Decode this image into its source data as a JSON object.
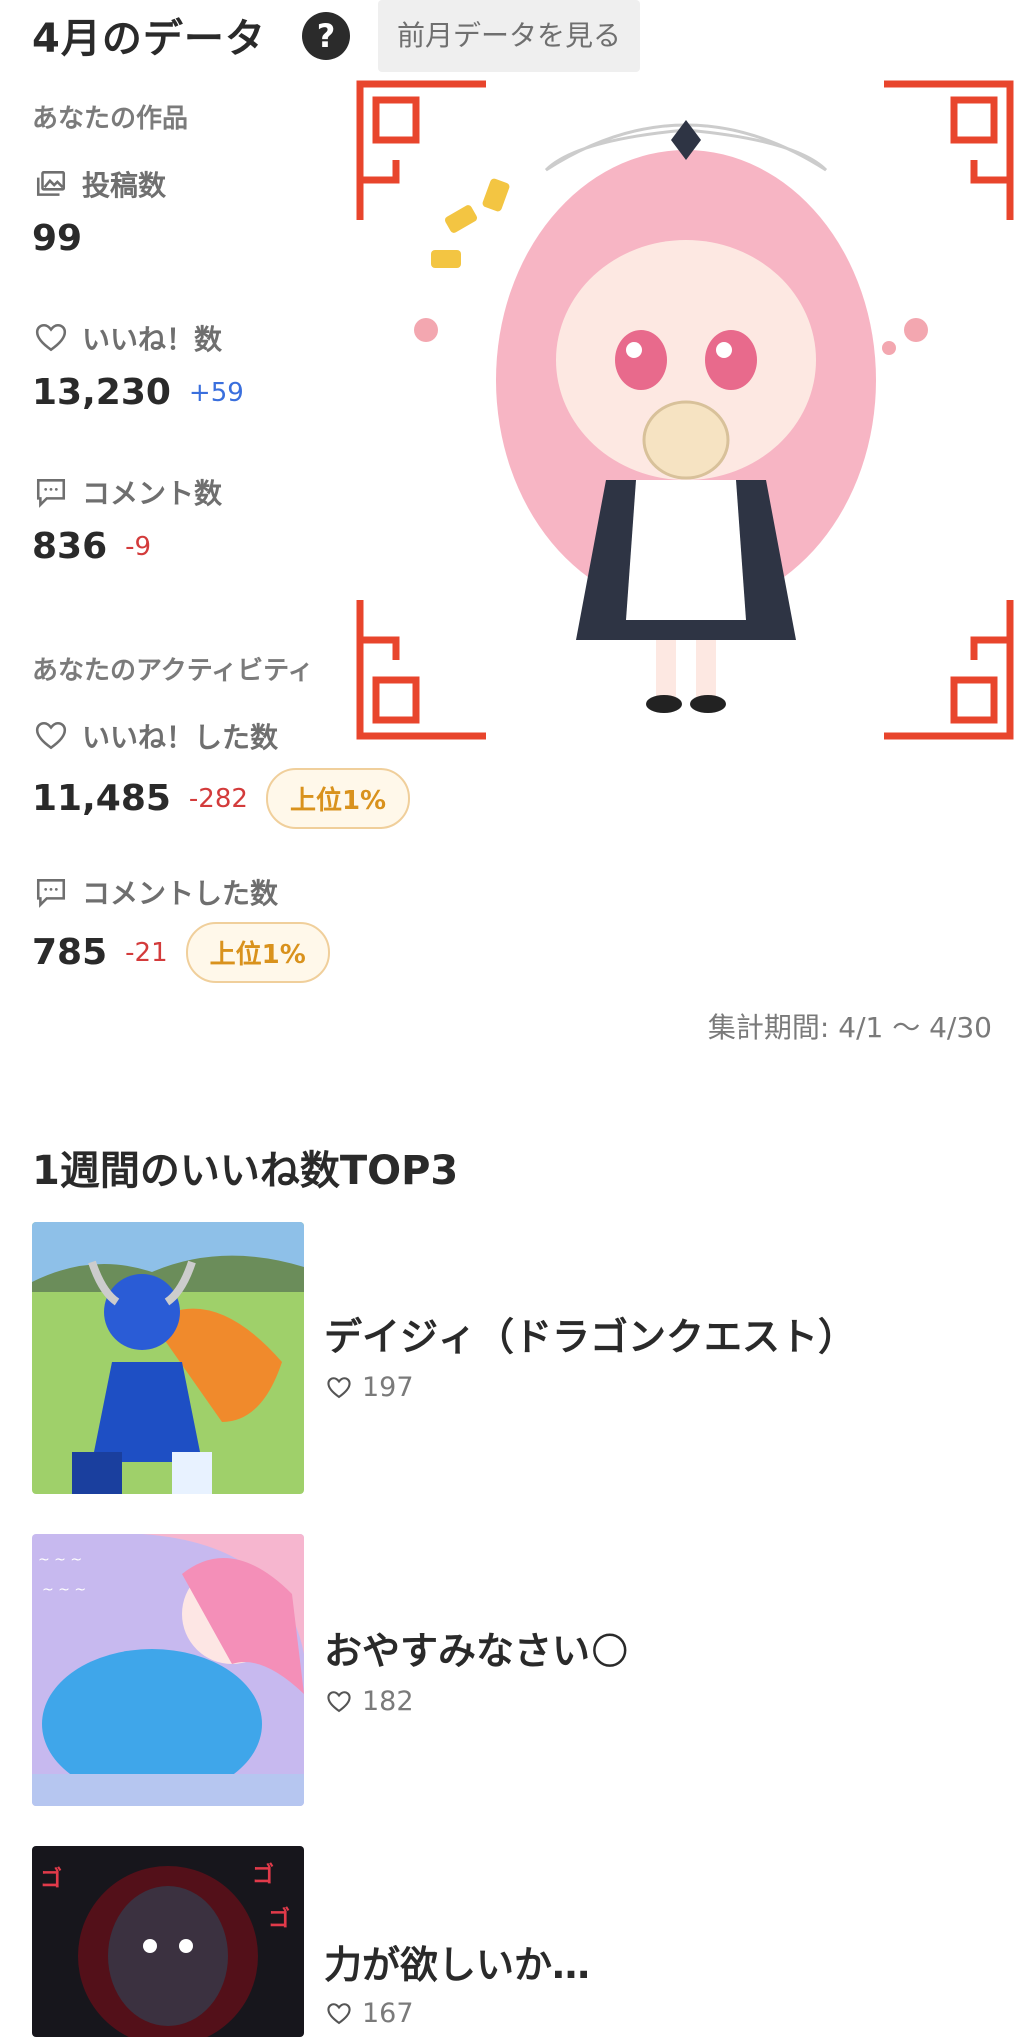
{
  "header": {
    "title": "4月のデータ",
    "help_icon_label": "?",
    "prev_button": "前月データを見る"
  },
  "works": {
    "section_label": "あなたの作品",
    "posts": {
      "label": "投稿数",
      "value": "99"
    },
    "likes": {
      "label": "いいね！数",
      "value": "13,230",
      "delta": "+59"
    },
    "comments": {
      "label": "コメント数",
      "value": "836",
      "delta": "-9"
    }
  },
  "activity": {
    "section_label": "あなたのアクティビティ",
    "likes_given": {
      "label": "いいね！した数",
      "value": "11,485",
      "delta": "-282",
      "badge": "上位1%"
    },
    "comments_given": {
      "label": "コメントした数",
      "value": "785",
      "delta": "-21",
      "badge": "上位1%"
    }
  },
  "period": "集計期間: 4/1 〜 4/30",
  "top3": {
    "title": "1週間のいいね数TOP3",
    "items": [
      {
        "title": "デイジィ（ドラゴンクエスト）",
        "likes": "197"
      },
      {
        "title": "おやすみなさい🌕",
        "likes": "182"
      },
      {
        "title": "力が欲しいか…",
        "likes": "167"
      }
    ]
  },
  "colors": {
    "accent_blue": "#3a6fdd",
    "negative_red": "#d33b3b",
    "badge_gold": "#d9921d",
    "frame_red": "#e8452c"
  },
  "icons": {
    "help": "question-circle-icon",
    "posts": "gallery-icon",
    "likes": "heart-icon",
    "comments": "speech-bubble-icon"
  }
}
